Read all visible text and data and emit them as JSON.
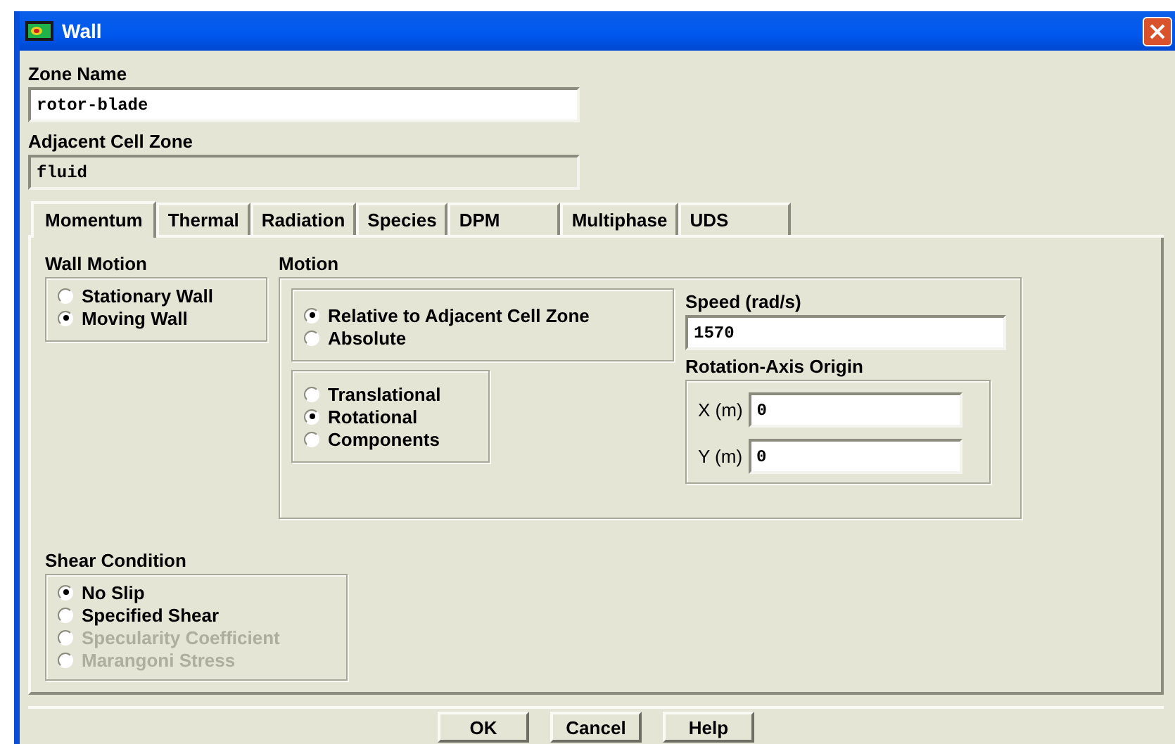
{
  "window": {
    "title": "Wall"
  },
  "zone_name": {
    "label": "Zone Name",
    "value": "rotor-blade",
    "readonly": false
  },
  "adjacent_cell_zone": {
    "label": "Adjacent Cell Zone",
    "value": "fluid",
    "readonly": true
  },
  "tabs": [
    {
      "label": "Momentum",
      "selected": true
    },
    {
      "label": "Thermal",
      "selected": false
    },
    {
      "label": "Radiation",
      "selected": false
    },
    {
      "label": "Species",
      "selected": false
    },
    {
      "label": "DPM",
      "selected": false
    },
    {
      "label": "Multiphase",
      "selected": false
    },
    {
      "label": "UDS",
      "selected": false
    }
  ],
  "wall_motion": {
    "label": "Wall Motion",
    "options": [
      {
        "label": "Stationary Wall",
        "selected": false,
        "disabled": false
      },
      {
        "label": "Moving Wall",
        "selected": true,
        "disabled": false
      }
    ]
  },
  "motion": {
    "label": "Motion",
    "reference": [
      {
        "label": "Relative to Adjacent Cell Zone",
        "selected": true,
        "disabled": false
      },
      {
        "label": "Absolute",
        "selected": false,
        "disabled": false
      }
    ],
    "type": [
      {
        "label": "Translational",
        "selected": false,
        "disabled": false
      },
      {
        "label": "Rotational",
        "selected": true,
        "disabled": false
      },
      {
        "label": "Components",
        "selected": false,
        "disabled": false
      }
    ],
    "speed": {
      "label": "Speed (rad/s)",
      "value": "1570",
      "readonly": false
    },
    "rotation_axis_origin": {
      "label": "Rotation-Axis Origin",
      "fields": [
        {
          "label": "X (m)",
          "value": "0",
          "readonly": false
        },
        {
          "label": "Y (m)",
          "value": "0",
          "readonly": false
        }
      ]
    }
  },
  "shear_condition": {
    "label": "Shear Condition",
    "options": [
      {
        "label": "No Slip",
        "selected": true,
        "disabled": false
      },
      {
        "label": "Specified Shear",
        "selected": false,
        "disabled": false
      },
      {
        "label": "Specularity Coefficient",
        "selected": false,
        "disabled": true
      },
      {
        "label": "Marangoni Stress",
        "selected": false,
        "disabled": true
      }
    ]
  },
  "buttons": [
    "OK",
    "Cancel",
    "Help"
  ]
}
